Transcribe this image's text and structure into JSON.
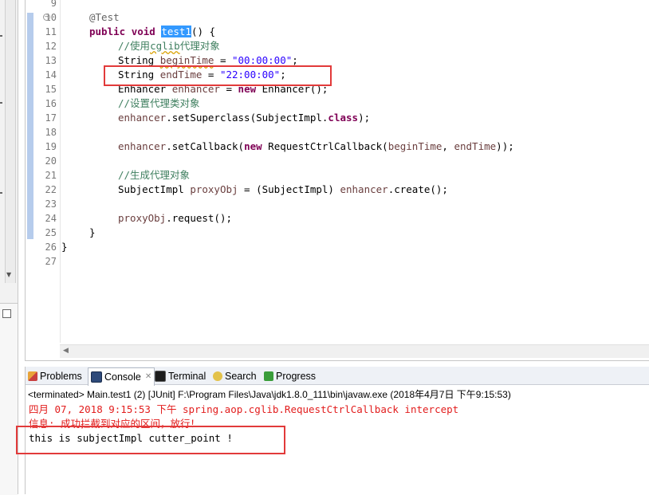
{
  "editor": {
    "lines": [
      {
        "n": "9"
      },
      {
        "n": "10"
      },
      {
        "n": "11"
      },
      {
        "n": "12"
      },
      {
        "n": "13"
      },
      {
        "n": "14"
      },
      {
        "n": "15"
      },
      {
        "n": "16"
      },
      {
        "n": "17"
      },
      {
        "n": "18"
      },
      {
        "n": "19"
      },
      {
        "n": "20"
      },
      {
        "n": "21"
      },
      {
        "n": "22"
      },
      {
        "n": "23"
      },
      {
        "n": "24"
      },
      {
        "n": "25"
      },
      {
        "n": "26"
      },
      {
        "n": "27"
      }
    ],
    "code": {
      "l10_annotation": "@Test",
      "l11_public": "public",
      "l11_void": "void",
      "l11_method": "test1",
      "l11_rest": "() {",
      "l12_comment_a": "//使用",
      "l12_comment_b": "cglib",
      "l12_comment_c": "代理对象",
      "l13_type": "String",
      "l13_var": "beginTime",
      "l13_eq": " = ",
      "l13_str": "\"00:00:00\"",
      "l13_end": ";",
      "l14_type": "String",
      "l14_var": "endTime",
      "l14_eq": " = ",
      "l14_str": "\"22:00:00\"",
      "l14_end": ";",
      "l15_type": "Enhancer",
      "l15_var": "enhancer",
      "l15_eq": " = ",
      "l15_new": "new",
      "l15_rest": " Enhancer();",
      "l16_comment": "//设置代理类对象",
      "l17_obj": "enhancer",
      "l17_call": ".setSuperclass(SubjectImpl.",
      "l17_class": "class",
      "l17_end": ");",
      "l19_obj": "enhancer",
      "l19_call": ".setCallback(",
      "l19_new": "new",
      "l19_mid": " RequestCtrlCallback(",
      "l19_arg1": "beginTime",
      "l19_comma": ", ",
      "l19_arg2": "endTime",
      "l19_end": "));",
      "l21_comment": "//生成代理对象",
      "l22_type": "SubjectImpl ",
      "l22_var": "proxyObj",
      "l22_mid": " = (SubjectImpl) ",
      "l22_obj": "enhancer",
      "l22_end": ".create();",
      "l24_var": "proxyObj",
      "l24_end": ".request();",
      "l25": "}",
      "l26": "}"
    }
  },
  "views": {
    "tabs": [
      {
        "label": "Problems"
      },
      {
        "label": "Console"
      },
      {
        "label": "Terminal"
      },
      {
        "label": "Search"
      },
      {
        "label": "Progress"
      }
    ],
    "close_glyph": "✕",
    "console_status": "<terminated> Main.test1 (2) [JUnit] F:\\Program Files\\Java\\jdk1.8.0_111\\bin\\javaw.exe (2018年4月7日 下午9:15:53)",
    "output": [
      "四月 07, 2018 9:15:53 下午 spring.aop.cglib.RequestCtrlCallback intercept",
      "信息: 成功拦截到对应的区间，放行！",
      "this is subjectImpl cutter_point !"
    ]
  },
  "colors": {
    "keyword": "#7f0055",
    "comment": "#3f7f5f",
    "string": "#2a00ff",
    "error_output": "#e21d1d",
    "highlight_box": "#e23a3a",
    "selection": "#3399ff"
  }
}
